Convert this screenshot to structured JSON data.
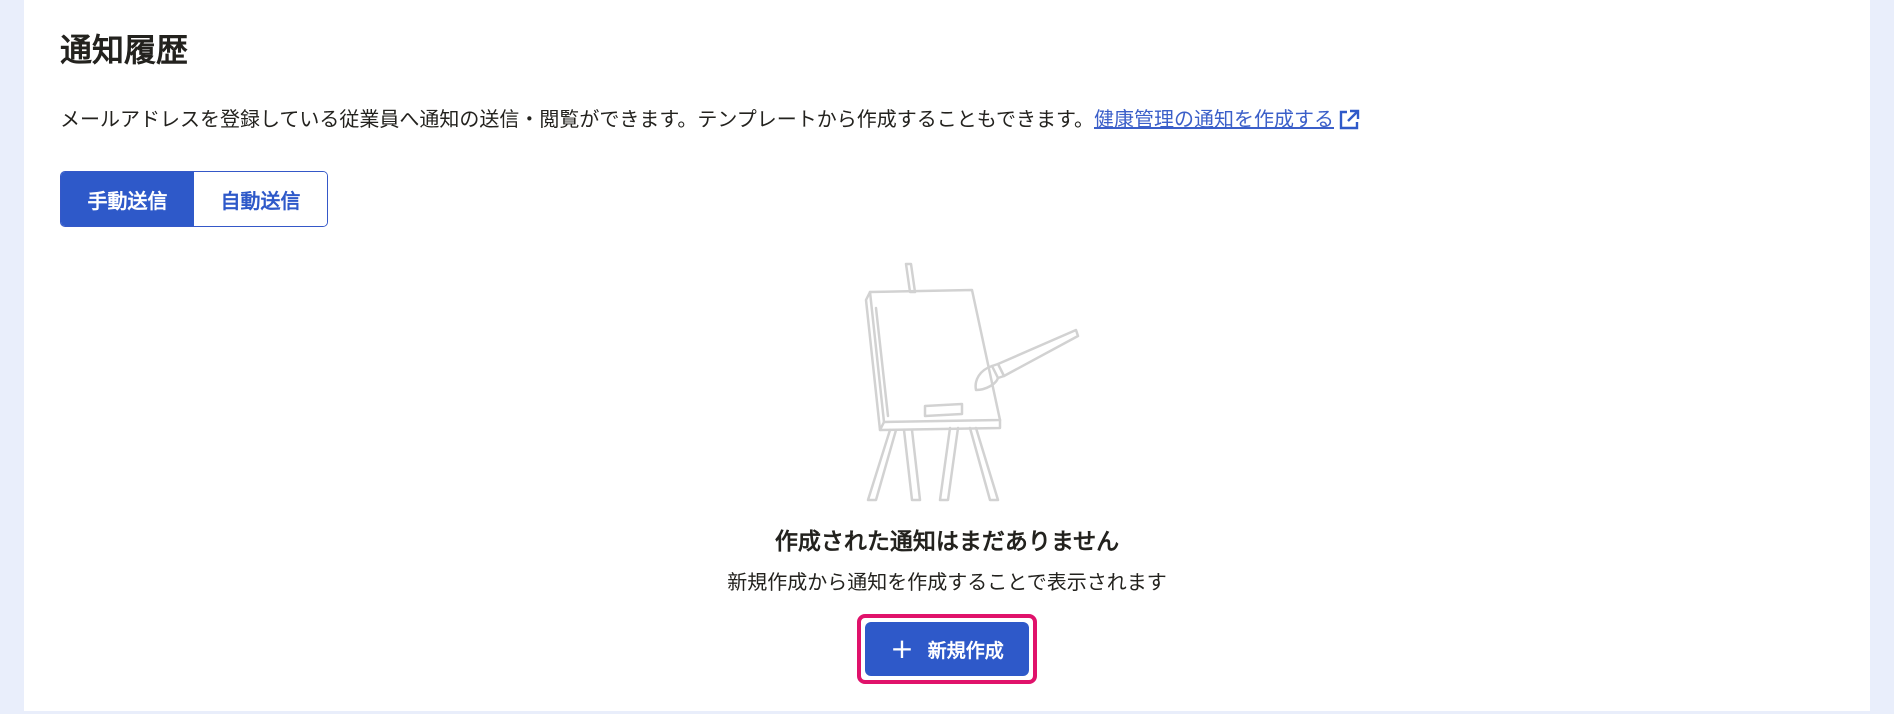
{
  "page": {
    "title": "通知履歴",
    "description": "メールアドレスを登録している従業員へ通知の送信・閲覧ができます。テンプレートから作成することもできます。",
    "link_label": "健康管理の通知を作成する",
    "link_icon": "external-link-icon"
  },
  "tabs": [
    {
      "label": "手動送信",
      "active": true
    },
    {
      "label": "自動送信",
      "active": false
    }
  ],
  "empty_state": {
    "illustration": "easel-paintbrush-illustration",
    "title": "作成された通知はまだありません",
    "subtitle": "新規作成から通知を作成することで表示されます",
    "button_label": "新規作成",
    "button_icon": "plus-icon"
  },
  "colors": {
    "primary": "#2e59c9",
    "link": "#3b5fc9",
    "highlight": "#e0126b",
    "background": "#e9eefb"
  }
}
